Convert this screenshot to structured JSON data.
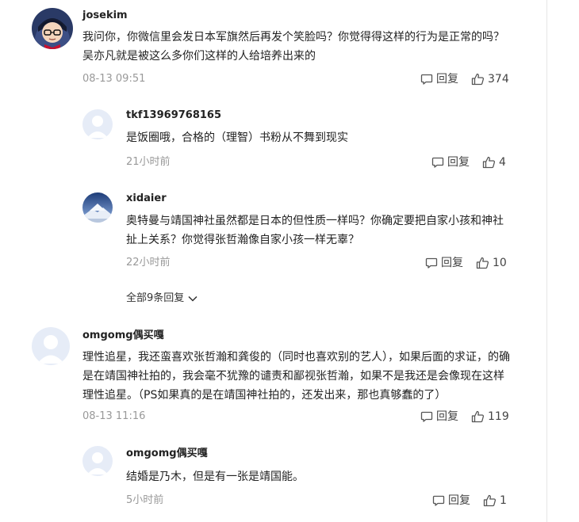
{
  "comments": [
    {
      "user": "josekim",
      "text": "我问你，你微信里会发日本军旗然后再发个笑脸吗？你觉得得这样的行为是正常的吗？吴亦凡就是被这么多你们这样的人给培养出来的",
      "time": "08-13 09:51",
      "reply_label": "回复",
      "likes": "374",
      "avatar": "cartoon-avatar"
    },
    {
      "user": "tkf13969768165",
      "text": "是饭圈哦，合格的（理智）书粉从不舞到现实",
      "time": "21小时前",
      "reply_label": "回复",
      "likes": "4",
      "avatar": "default-user-avatar"
    },
    {
      "user": "xidaier",
      "text": "奥特曼与靖国神社虽然都是日本的但性质一样吗？你确定要把自家小孩和神社扯上关系？你觉得张哲瀚像自家小孩一样无辜？",
      "time": "22小时前",
      "reply_label": "回复",
      "likes": "10",
      "avatar": "mountain-landscape-avatar"
    },
    {
      "user": "omgomg偶买嘎",
      "text": "理性追星，我还蛮喜欢张哲瀚和龚俊的（同时也喜欢别的艺人），如果后面的求证，的确是在靖国神社拍的，我会毫不犹豫的谴责和鄙视张哲瀚，如果不是我还是会像现在这样理性追星。（PS如果真的是在靖国神社拍的，还发出来，那也真够蠢的了）",
      "time": "08-13 11:16",
      "reply_label": "回复",
      "likes": "119",
      "avatar": "default-user-avatar"
    },
    {
      "user": "omgomg偶买嘎",
      "text": "结婚是乃木，但是有一张是靖国能。",
      "time": "5小时前",
      "reply_label": "回复",
      "likes": "1",
      "avatar": "default-user-avatar"
    }
  ],
  "show_all_replies": "全部9条回复",
  "colors": {
    "meta_gray": "#999999",
    "text_dark": "#222222",
    "avatar_default_bg": "#e6ecf7"
  }
}
